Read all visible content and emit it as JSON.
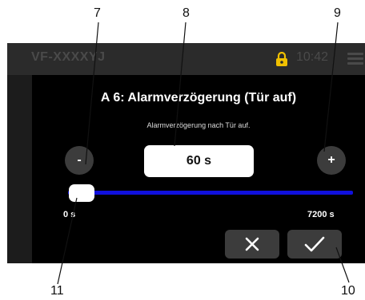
{
  "status_bar": {
    "device_id": "VF-XXXXYJ",
    "time": "10:42",
    "lock_icon": "padlock-icon",
    "menu_icon": "hamburger-menu-icon",
    "accent_color": "#f0c000"
  },
  "dialog": {
    "title": "A 6: Alarmverzögerung (Tür auf)",
    "subtitle": "Alarmverzögerung nach Tür auf.",
    "decrement_label": "-",
    "increment_label": "+",
    "value": "60 s",
    "slider": {
      "min_label": "0 s",
      "max_label": "7200 s",
      "min": 0,
      "max": 7200,
      "current": 60,
      "track_color": "#1010dd"
    },
    "cancel_icon": "close-x-icon",
    "confirm_icon": "checkmark-icon"
  },
  "callouts": {
    "c7": "7",
    "c8": "8",
    "c9": "9",
    "c10": "10",
    "c11": "11"
  }
}
